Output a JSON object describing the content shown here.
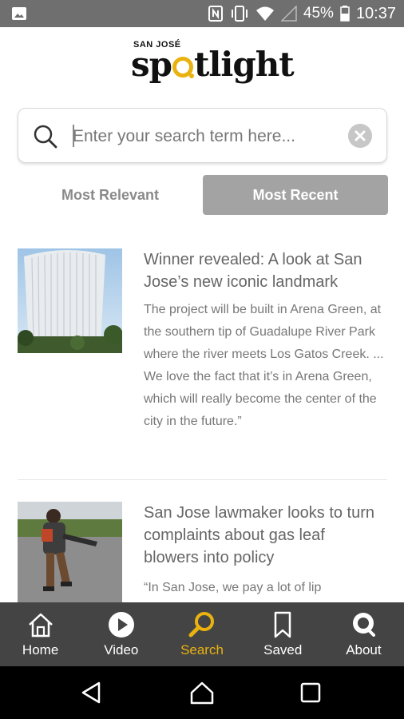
{
  "status_bar": {
    "battery": "45%",
    "time": "10:37",
    "icons": [
      "image-icon",
      "nfc-icon",
      "vibrate-icon",
      "wifi-icon",
      "signal-icon",
      "battery-icon"
    ]
  },
  "logo": {
    "small_text": "SAN JOSÉ",
    "main_text_before": "sp",
    "main_text_after": "tlight",
    "accent_color": "#e9b20f"
  },
  "search": {
    "placeholder": "Enter your search term here...",
    "value": ""
  },
  "sort": {
    "options": [
      "Most Relevant",
      "Most Recent"
    ],
    "selected": "Most Recent"
  },
  "articles": [
    {
      "title": "Winner revealed: A look at San Jose’s new iconic landmark",
      "body": "The project will be built in Arena Green, at the southern tip of Guadalupe River Park where the river meets Los Gatos Creek. ... We love the fact that it’s in Arena Green, which will really become the center of the city in the future.”"
    },
    {
      "title": "San Jose lawmaker looks to turn complaints about gas leaf blowers into policy",
      "body": "“In San Jose, we pay a lot of lip"
    }
  ],
  "bottom_nav": {
    "items": [
      {
        "label": "Home",
        "icon": "home-icon"
      },
      {
        "label": "Video",
        "icon": "play-icon"
      },
      {
        "label": "Search",
        "icon": "search-icon"
      },
      {
        "label": "Saved",
        "icon": "bookmark-icon"
      },
      {
        "label": "About",
        "icon": "about-icon"
      }
    ],
    "active": "Search",
    "active_color": "#e9b20f"
  },
  "system_nav": {
    "icons": [
      "back-icon",
      "home-circle-icon",
      "recent-apps-icon"
    ]
  }
}
